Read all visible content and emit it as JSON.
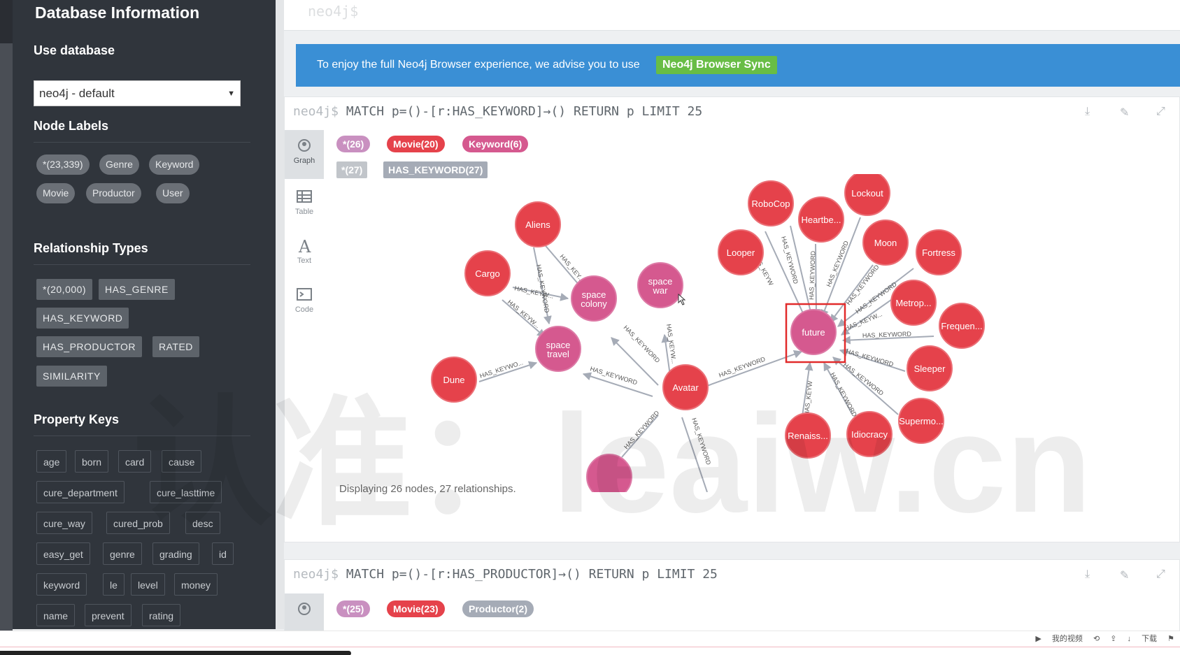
{
  "sidebar": {
    "title": "Database Information",
    "use_db_heading": "Use database",
    "db_selected": "neo4j - default",
    "node_labels_heading": "Node Labels",
    "node_labels": [
      "*(23,339)",
      "Genre",
      "Keyword",
      "Movie",
      "Productor",
      "User"
    ],
    "rel_types_heading": "Relationship Types",
    "rel_types": [
      "*(20,000)",
      "HAS_GENRE",
      "HAS_KEYWORD",
      "HAS_PRODUCTOR",
      "RATED",
      "SIMILARITY"
    ],
    "prop_keys_heading": "Property Keys",
    "prop_keys": [
      "age",
      "born",
      "card",
      "cause",
      "cure_department",
      "cure_lasttime",
      "cure_way",
      "cured_prob",
      "desc",
      "easy_get",
      "genre",
      "grading",
      "id",
      "keyword",
      "le",
      "level",
      "money",
      "name",
      "prevent",
      "rating"
    ]
  },
  "editor": {
    "prompt": "neo4j$"
  },
  "banner": {
    "text": "To enjoy the full Neo4j Browser experience, we advise you to use",
    "button": "Neo4j Browser Sync"
  },
  "frame1": {
    "prompt": "neo4j$",
    "query": "MATCH p=()-[r:HAS_KEYWORD]→() RETURN p LIMIT 25",
    "tabs": [
      "Graph",
      "Table",
      "Text",
      "Code"
    ],
    "node_chips": [
      "*(26)",
      "Movie(20)",
      "Keyword(6)"
    ],
    "rel_chips": [
      "*(27)",
      "HAS_KEYWORD(27)"
    ],
    "status": "Displaying 26 nodes, 27 relationships.",
    "nodes": {
      "aliens": "Aliens",
      "cargo": "Cargo",
      "space_colony": "space\ncolony",
      "space_war": "space\nwar",
      "space_travel": "space\ntravel",
      "dune": "Dune",
      "avatar": "Avatar",
      "robocop": "RoboCop",
      "heartbe": "Heartbe...",
      "lockout": "Lockout",
      "looper": "Looper",
      "moon": "Moon",
      "fortress": "Fortress",
      "metrop": "Metrop...",
      "future": "future",
      "frequen": "Frequen...",
      "sleeper": "Sleeper",
      "supermo": "Supermo...",
      "idiocracy": "Idiocracy",
      "renaiss": "Renaiss..."
    },
    "edge_label": "HAS_KEYWORD",
    "edge_label_short": [
      "HAS_KEY...",
      "HAS_KEYW...",
      "HAS_KEYWO...",
      "HAS_KEYW"
    ]
  },
  "frame2": {
    "prompt": "neo4j$",
    "query": "MATCH p=()-[r:HAS_PRODUCTOR]→() RETURN p LIMIT 25",
    "node_chips": [
      "*(25)",
      "Movie(23)",
      "Productor(2)"
    ]
  },
  "statusbar": {
    "my_video": "我的视频",
    "download": "下载"
  },
  "watermark": "认准：leaiw.cn",
  "colors": {
    "movie": "#e5424b",
    "keyword": "#d5598f",
    "sidebar": "#30353c",
    "banner": "#3a8fd5",
    "sync": "#68bd45"
  }
}
